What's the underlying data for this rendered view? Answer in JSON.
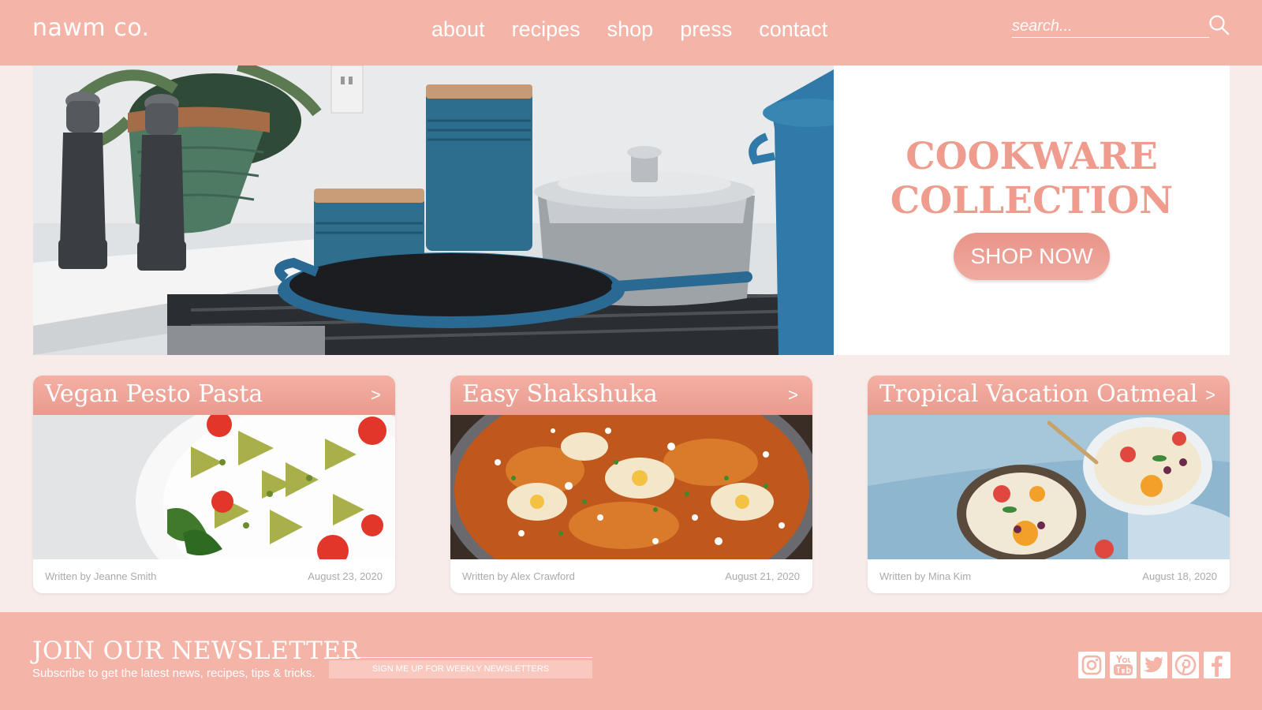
{
  "header": {
    "logo": "nawm co.",
    "nav": [
      "about",
      "recipes",
      "shop",
      "press",
      "contact"
    ],
    "search_placeholder": "search..."
  },
  "hero": {
    "title_line1": "COOKWARE",
    "title_line2": "COLLECTION",
    "button": "SHOP NOW"
  },
  "cards": [
    {
      "title": "Vegan Pesto Pasta",
      "arrow": ">",
      "author": "Written by Jeanne Smith",
      "date": "August 23, 2020"
    },
    {
      "title": "Easy Shakshuka",
      "arrow": ">",
      "author": "Written by Alex Crawford",
      "date": "August 21, 2020"
    },
    {
      "title": "Tropical Vacation Oatmeal",
      "arrow": ">",
      "author": "Written by Mina Kim",
      "date": "August 18, 2020"
    }
  ],
  "footer": {
    "newsletter_title": "JOIN OUR NEWSLETTER",
    "newsletter_subtitle": "Subscribe to get the latest news, recipes, tips & tricks.",
    "signup_button": "SIGN ME UP FOR WEEKLY NEWSLETTERS",
    "social_icons": [
      "instagram-icon",
      "youtube-icon",
      "twitter-icon",
      "pinterest-icon",
      "facebook-icon"
    ]
  },
  "colors": {
    "header_pink": "#f4b4a8",
    "accent_coral": "#ef9c8e",
    "page_bg": "#f7ecea"
  }
}
